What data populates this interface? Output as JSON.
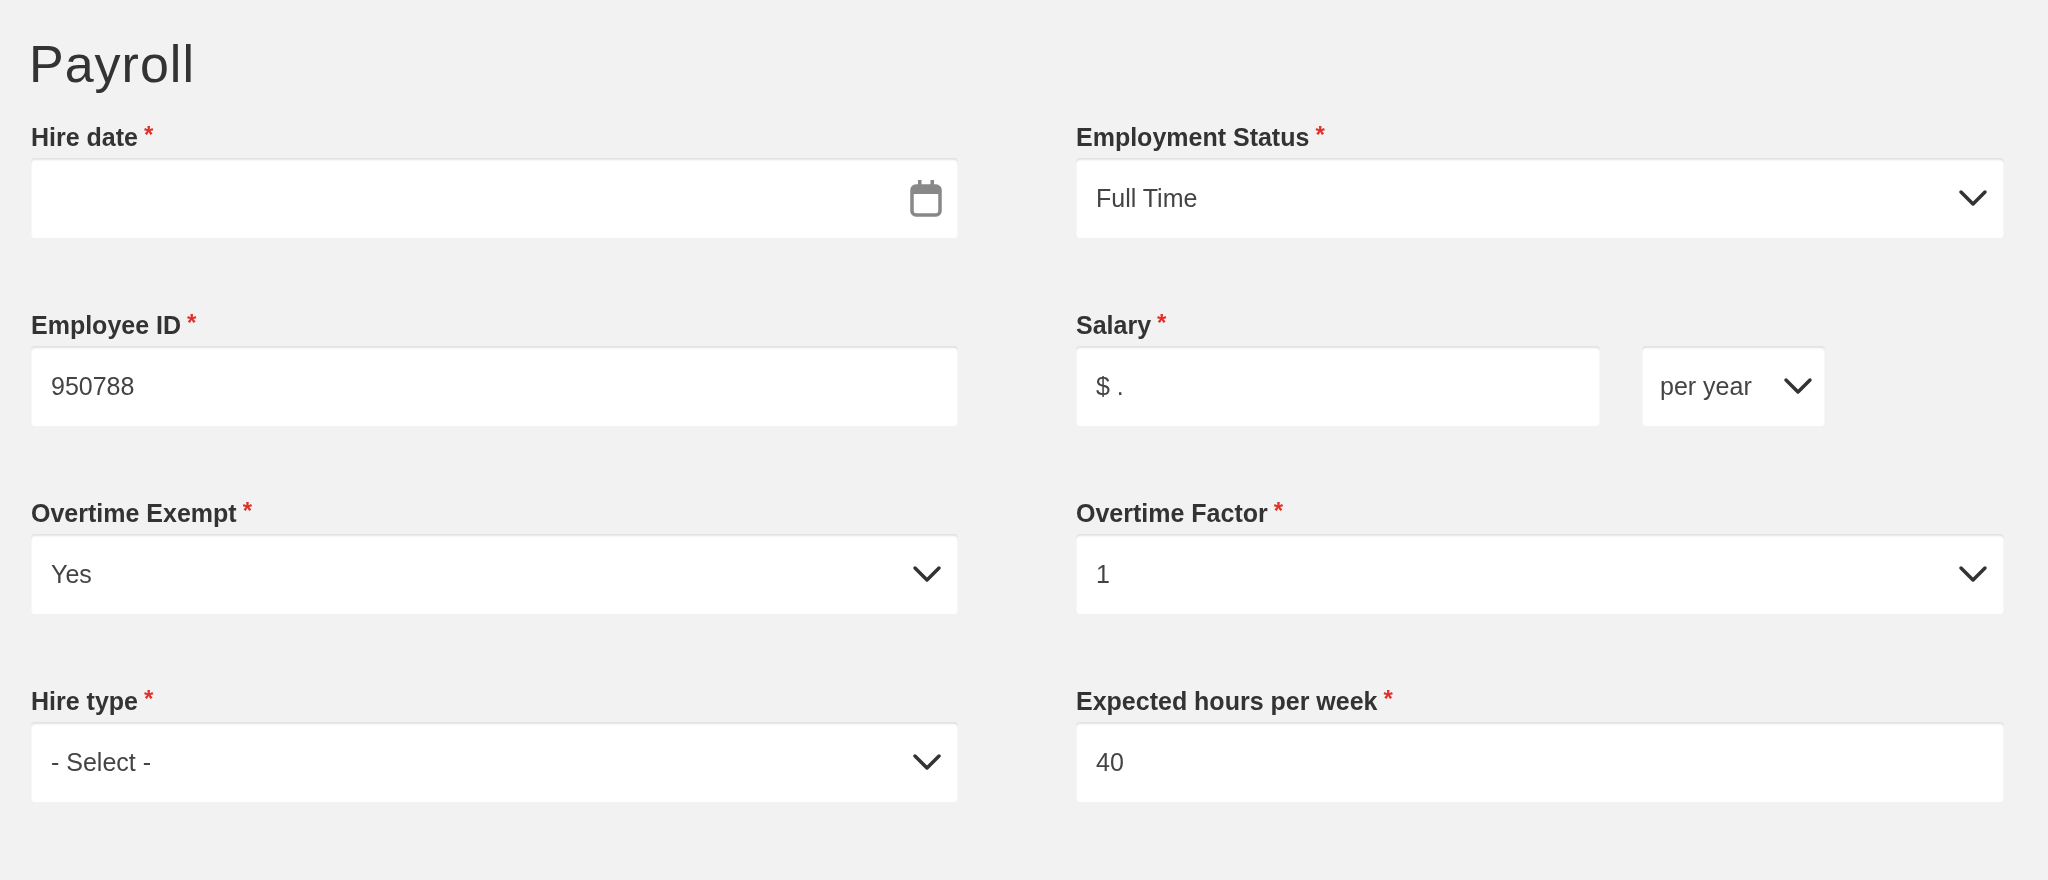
{
  "title": "Payroll",
  "fields": [
    {
      "kind": "date",
      "label": "Hire date",
      "required_mark": "*"
    },
    {
      "kind": "select",
      "label": "Employment Status",
      "required_mark": "*",
      "value": "Full Time"
    },
    {
      "kind": "text",
      "label": "Employee ID",
      "required_mark": "*",
      "value": "950788"
    },
    {
      "kind": "money",
      "label": "Salary",
      "required_mark": "*",
      "value": "$ .",
      "unit": "per year"
    },
    {
      "kind": "select",
      "label": "Overtime Exempt",
      "required_mark": "*",
      "value": "Yes"
    },
    {
      "kind": "select",
      "label": "Overtime Factor",
      "required_mark": "*",
      "value": "1"
    },
    {
      "kind": "select",
      "label": "Hire type",
      "required_mark": "*",
      "value": "- Select -"
    },
    {
      "kind": "text",
      "label": "Expected hours per week",
      "required_mark": "*",
      "value": "40"
    }
  ]
}
